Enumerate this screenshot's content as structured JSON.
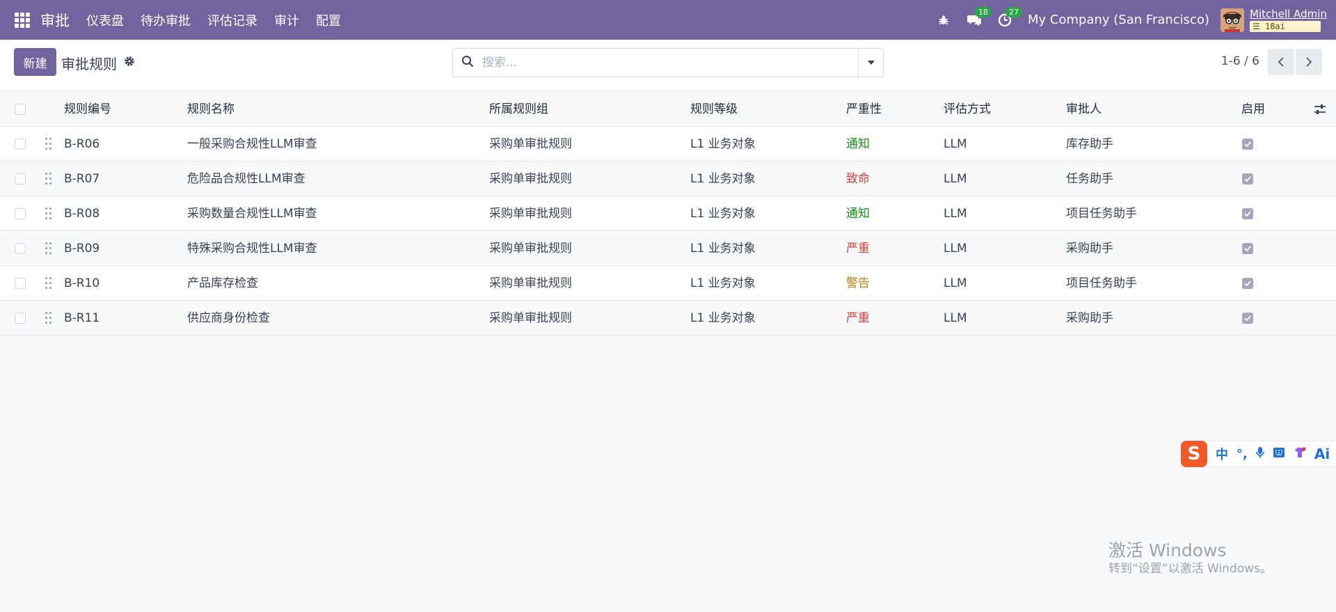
{
  "navbar": {
    "brand": "审批",
    "menu": [
      "仪表盘",
      "待办审批",
      "评估记录",
      "审计",
      "配置"
    ],
    "messages_count": "18",
    "activities_count": "27",
    "company": "My Company (San Francisco)",
    "user_name": "Mitchell Admin",
    "db_name": "18ai"
  },
  "control": {
    "new_label": "新建",
    "title": "审批规则",
    "search_placeholder": "搜索...",
    "pager": "1-6 / 6"
  },
  "table": {
    "columns": [
      "规则编号",
      "规则名称",
      "所属规则组",
      "规则等级",
      "严重性",
      "评估方式",
      "审批人",
      "启用"
    ],
    "rows": [
      {
        "code": "B-R06",
        "name": "一般采购合规性LLM审查",
        "group": "采购单审批规则",
        "level": "L1 业务对象",
        "severity": "通知",
        "severity_color": "#1a8d1a",
        "method": "LLM",
        "approver": "库存助手",
        "enabled": true
      },
      {
        "code": "B-R07",
        "name": "危险品合规性LLM审查",
        "group": "采购单审批规则",
        "level": "L1 业务对象",
        "severity": "致命",
        "severity_color": "#d23f3a",
        "method": "LLM",
        "approver": "任务助手",
        "enabled": true
      },
      {
        "code": "B-R08",
        "name": "采购数量合规性LLM审查",
        "group": "采购单审批规则",
        "level": "L1 业务对象",
        "severity": "通知",
        "severity_color": "#1a8d1a",
        "method": "LLM",
        "approver": "项目任务助手",
        "enabled": true
      },
      {
        "code": "B-R09",
        "name": "特殊采购合规性LLM审查",
        "group": "采购单审批规则",
        "level": "L1 业务对象",
        "severity": "严重",
        "severity_color": "#d23f3a",
        "method": "LLM",
        "approver": "采购助手",
        "enabled": true
      },
      {
        "code": "B-R10",
        "name": "产品库存检查",
        "group": "采购单审批规则",
        "level": "L1 业务对象",
        "severity": "警告",
        "severity_color": "#b7841a",
        "method": "LLM",
        "approver": "项目任务助手",
        "enabled": true
      },
      {
        "code": "B-R11",
        "name": "供应商身份检查",
        "group": "采购单审批规则",
        "level": "L1 业务对象",
        "severity": "严重",
        "severity_color": "#d23f3a",
        "method": "LLM",
        "approver": "采购助手",
        "enabled": true
      }
    ]
  },
  "ime": {
    "lang": "中",
    "ai": "Ai"
  },
  "watermark": {
    "title": "激活 Windows",
    "subtitle": "转到“设置”以激活 Windows。"
  },
  "colors": {
    "brand": "#71639e",
    "badge": "#28a745"
  }
}
